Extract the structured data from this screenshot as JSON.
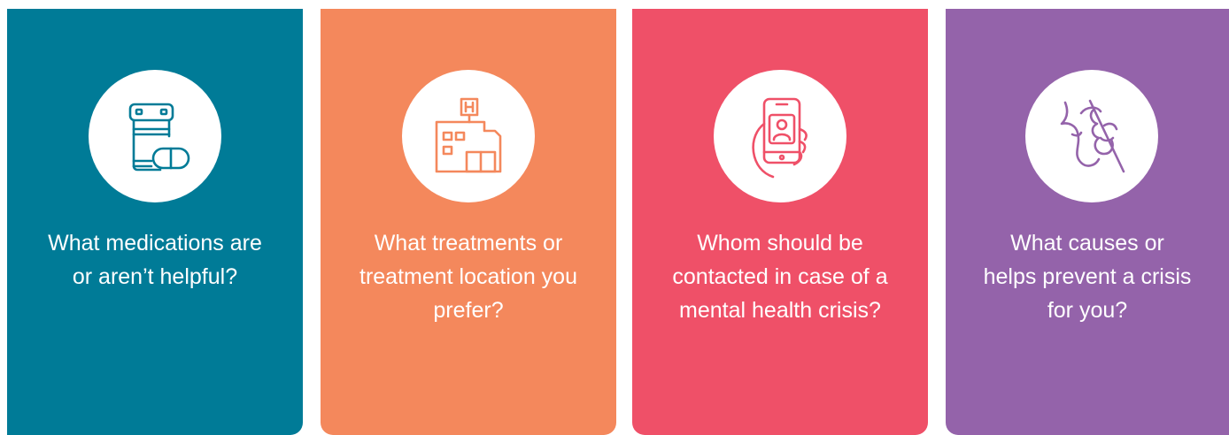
{
  "colors": {
    "teal": "#007b97",
    "orange": "#f4885c",
    "coral": "#ef5068",
    "purple": "#9463aa"
  },
  "cards": [
    {
      "icon": "pill-bottle-icon",
      "question": "What medications are or aren’t helpful?",
      "color": "#007b97"
    },
    {
      "icon": "hospital-icon",
      "question": "What treatments or treatment location you prefer?",
      "color": "#f4885c"
    },
    {
      "icon": "phone-contact-icon",
      "question": "Whom should be contacted in case of a mental health crisis?",
      "color": "#ef5068"
    },
    {
      "icon": "crisis-prevention-icon",
      "question": "What causes or helps prevent a crisis for you?",
      "color": "#9463aa"
    }
  ]
}
